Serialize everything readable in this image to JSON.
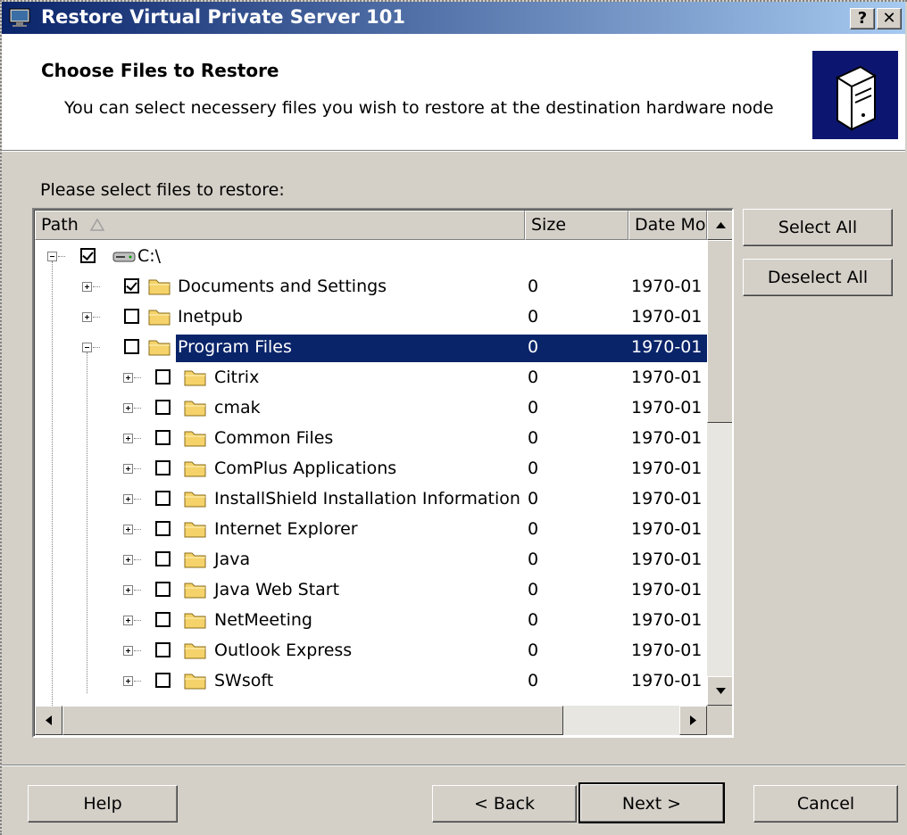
{
  "window": {
    "title": "Restore Virtual Private Server 101",
    "help_glyph": "?",
    "close_glyph": "✕"
  },
  "header": {
    "title": "Choose Files to Restore",
    "subtitle": "You can select necessery files you wish to restore at the destination hardware node"
  },
  "prompt": "Please select files to restore:",
  "columns": {
    "path": "Path",
    "size": "Size",
    "date": "Date Mo"
  },
  "rows": [
    {
      "name": "C:\\",
      "size": "",
      "date": "",
      "level": 0,
      "checked": true,
      "expanded": true,
      "icon": "drive-icon",
      "selected": false
    },
    {
      "name": "Documents and Settings",
      "size": "0",
      "date": "1970-01",
      "level": 1,
      "checked": true,
      "expanded": false,
      "icon": "folder-icon",
      "selected": false
    },
    {
      "name": "Inetpub",
      "size": "0",
      "date": "1970-01",
      "level": 1,
      "checked": false,
      "expanded": false,
      "icon": "folder-icon",
      "selected": false
    },
    {
      "name": "Program Files",
      "size": "0",
      "date": "1970-01",
      "level": 1,
      "checked": false,
      "expanded": true,
      "icon": "folder-icon",
      "selected": true
    },
    {
      "name": "Citrix",
      "size": "0",
      "date": "1970-01",
      "level": 2,
      "checked": false,
      "expanded": false,
      "icon": "folder-icon",
      "selected": false
    },
    {
      "name": "cmak",
      "size": "0",
      "date": "1970-01",
      "level": 2,
      "checked": false,
      "expanded": false,
      "icon": "folder-icon",
      "selected": false
    },
    {
      "name": "Common Files",
      "size": "0",
      "date": "1970-01",
      "level": 2,
      "checked": false,
      "expanded": false,
      "icon": "folder-icon",
      "selected": false
    },
    {
      "name": "ComPlus Applications",
      "size": "0",
      "date": "1970-01",
      "level": 2,
      "checked": false,
      "expanded": false,
      "icon": "folder-icon",
      "selected": false
    },
    {
      "name": "InstallShield Installation Information",
      "size": "0",
      "date": "1970-01",
      "level": 2,
      "checked": false,
      "expanded": false,
      "icon": "folder-icon",
      "selected": false
    },
    {
      "name": "Internet Explorer",
      "size": "0",
      "date": "1970-01",
      "level": 2,
      "checked": false,
      "expanded": false,
      "icon": "folder-icon",
      "selected": false
    },
    {
      "name": "Java",
      "size": "0",
      "date": "1970-01",
      "level": 2,
      "checked": false,
      "expanded": false,
      "icon": "folder-icon",
      "selected": false
    },
    {
      "name": "Java Web Start",
      "size": "0",
      "date": "1970-01",
      "level": 2,
      "checked": false,
      "expanded": false,
      "icon": "folder-icon",
      "selected": false
    },
    {
      "name": "NetMeeting",
      "size": "0",
      "date": "1970-01",
      "level": 2,
      "checked": false,
      "expanded": false,
      "icon": "folder-icon",
      "selected": false
    },
    {
      "name": "Outlook Express",
      "size": "0",
      "date": "1970-01",
      "level": 2,
      "checked": false,
      "expanded": false,
      "icon": "folder-icon",
      "selected": false
    },
    {
      "name": "SWsoft",
      "size": "0",
      "date": "1970-01",
      "level": 2,
      "checked": false,
      "expanded": false,
      "icon": "folder-icon",
      "selected": false
    }
  ],
  "side_buttons": {
    "select_all": "Select All",
    "deselect_all": "Deselect All"
  },
  "footer": {
    "help": "Help",
    "back": "< Back",
    "next": "Next >",
    "cancel": "Cancel"
  },
  "colors": {
    "title_start": "#0a246a",
    "title_end": "#a6caf0",
    "selection": "#0a246a",
    "dialog": "#d4d0c8",
    "folder": "#f5d36a"
  }
}
